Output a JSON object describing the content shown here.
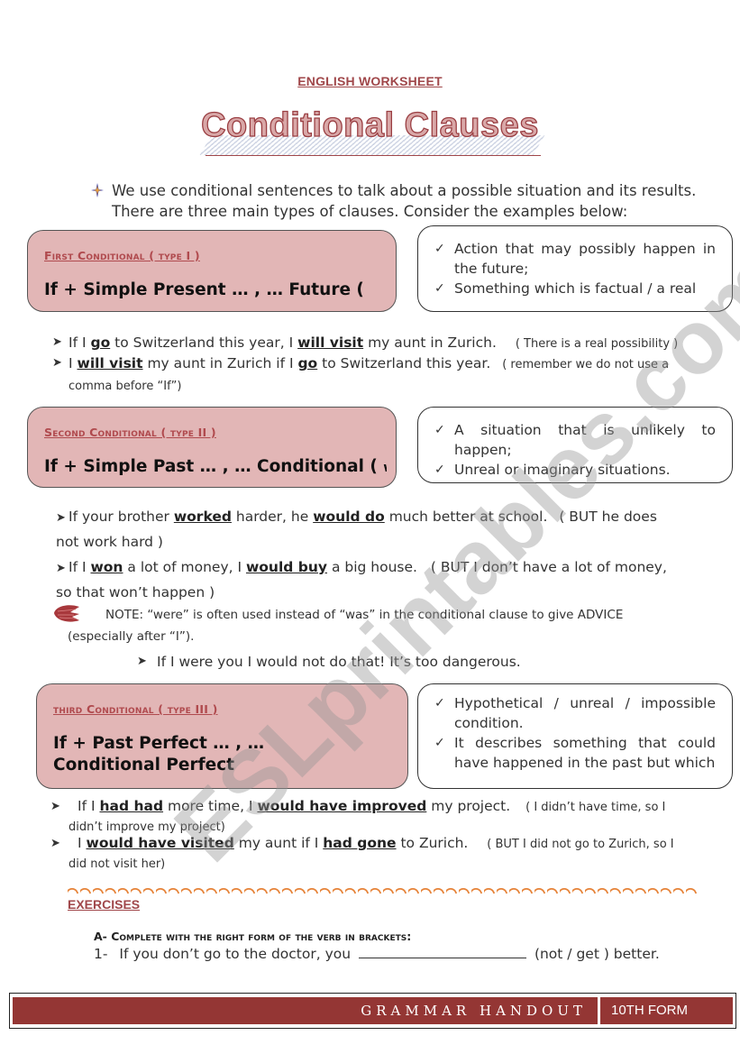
{
  "header": {
    "worksheet_label": "ENGLISH WORKSHEET",
    "title": "Conditional Clauses"
  },
  "intro": {
    "bullet_icon": "four-point-star-icon",
    "line1": "We use conditional sentences to talk about a possible situation and its results.",
    "line2": "There are three main types of clauses. Consider the examples below:"
  },
  "sections": [
    {
      "label": "First Conditional ( type I )",
      "formula": "If + Simple Present … , … Future ( will + inf.)",
      "notes": [
        "Action that may possibly happen in the future;",
        "Something which is factual / a real"
      ],
      "examples": [
        {
          "parts": [
            "If I ",
            "go",
            " to Switzerland this year, I ",
            "will visit",
            " my aunt in Zurich."
          ],
          "note": "( There is a real possibility )"
        },
        {
          "parts": [
            "I ",
            "will visit",
            " my aunt in Zurich if I ",
            "go",
            " to Switzerland this year."
          ],
          "note": "( remember we do not use a comma before “If”)"
        }
      ]
    },
    {
      "label": "Second Conditional ( type II )",
      "formula_main": "If + Simple Past … , … Conditional ( ",
      "formula_small": "would",
      "notes": [
        "A situation that is unlikely to happen;",
        "Unreal or imaginary situations."
      ],
      "examples": [
        {
          "parts": [
            "If your brother ",
            "worked",
            " harder, he ",
            "would do",
            " much better at school."
          ],
          "note": "( BUT he does not work hard )"
        },
        {
          "parts": [
            "If I ",
            "won",
            " a lot of money, I ",
            "would buy",
            " a big house."
          ],
          "note": "( BUT I don’t have a lot of money, so that won’t happen )"
        }
      ],
      "advice_note": {
        "icon": "red-arrow-note-icon",
        "text": "NOTE: “were” is often used instead of “was” in the conditional clause to give ADVICE (especially after “I”).",
        "example": "If I were you I would not do that! It’s too dangerous."
      }
    },
    {
      "label": "third Conditional ( type III )",
      "formula": "If + Past Perfect … , … Conditional Perfect",
      "notes": [
        "Hypothetical / unreal / impossible condition.",
        "It describes something that could have happened in the past but which"
      ],
      "examples": [
        {
          "parts": [
            "If I ",
            "had had",
            " more time, I ",
            "would have improved",
            " my project."
          ],
          "note": "( I didn’t have time, so I didn’t improve my project)"
        },
        {
          "parts": [
            "I ",
            "would have visited",
            " my aunt if I ",
            "had gone",
            " to Zurich."
          ],
          "note": "( BUT I did not go to Zurich, so I did not visit her)"
        }
      ]
    }
  ],
  "exercises": {
    "title": "EXERCISES",
    "task_title": "A-  Complete with the right form of the verb in brackets:",
    "items": [
      {
        "number": "1-",
        "before": "If you don’t go to the doctor, you",
        "after": "(not / get ) better."
      }
    ]
  },
  "footer": {
    "left": "GRAMMAR HANDOUT",
    "right": "10TH FORM"
  },
  "watermark": "ESLprintables.com",
  "colors": {
    "accent": "#a0474a",
    "rule_box_fill": "#e2b6b6",
    "footer_bar": "#943634",
    "wavy_rule": "#e6843a"
  }
}
